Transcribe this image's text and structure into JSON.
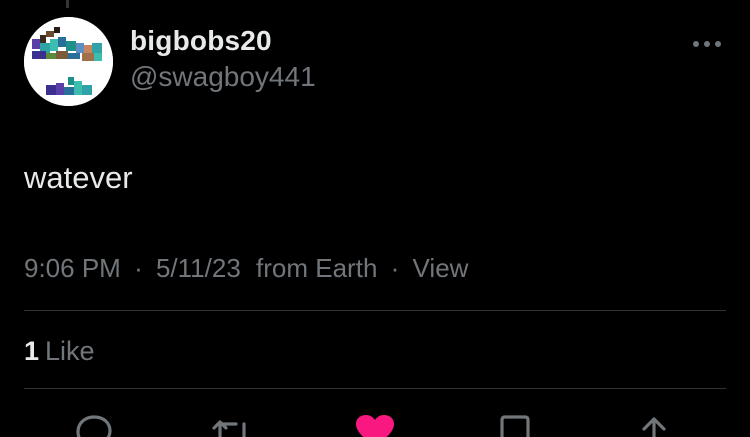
{
  "tweet": {
    "author": {
      "display_name": "bigbobs20",
      "handle": "@swagboy441"
    },
    "text": "watever",
    "meta": {
      "time": "9:06 PM",
      "separator": "·",
      "date": "5/11/23",
      "source": "from Earth",
      "view_label": "View"
    },
    "stats": {
      "likes_count": "1",
      "likes_label": "Like"
    },
    "actions": [
      {
        "name": "reply-icon"
      },
      {
        "name": "retweet-icon"
      },
      {
        "name": "like-heart-icon",
        "liked": true,
        "color": "#f91880"
      },
      {
        "name": "bookmark-icon"
      },
      {
        "name": "share-icon"
      }
    ]
  },
  "colors": {
    "background": "#000000",
    "text_primary": "#e7e9ea",
    "text_secondary": "#71767b",
    "divider": "#2f3336",
    "like_accent": "#f91880"
  }
}
